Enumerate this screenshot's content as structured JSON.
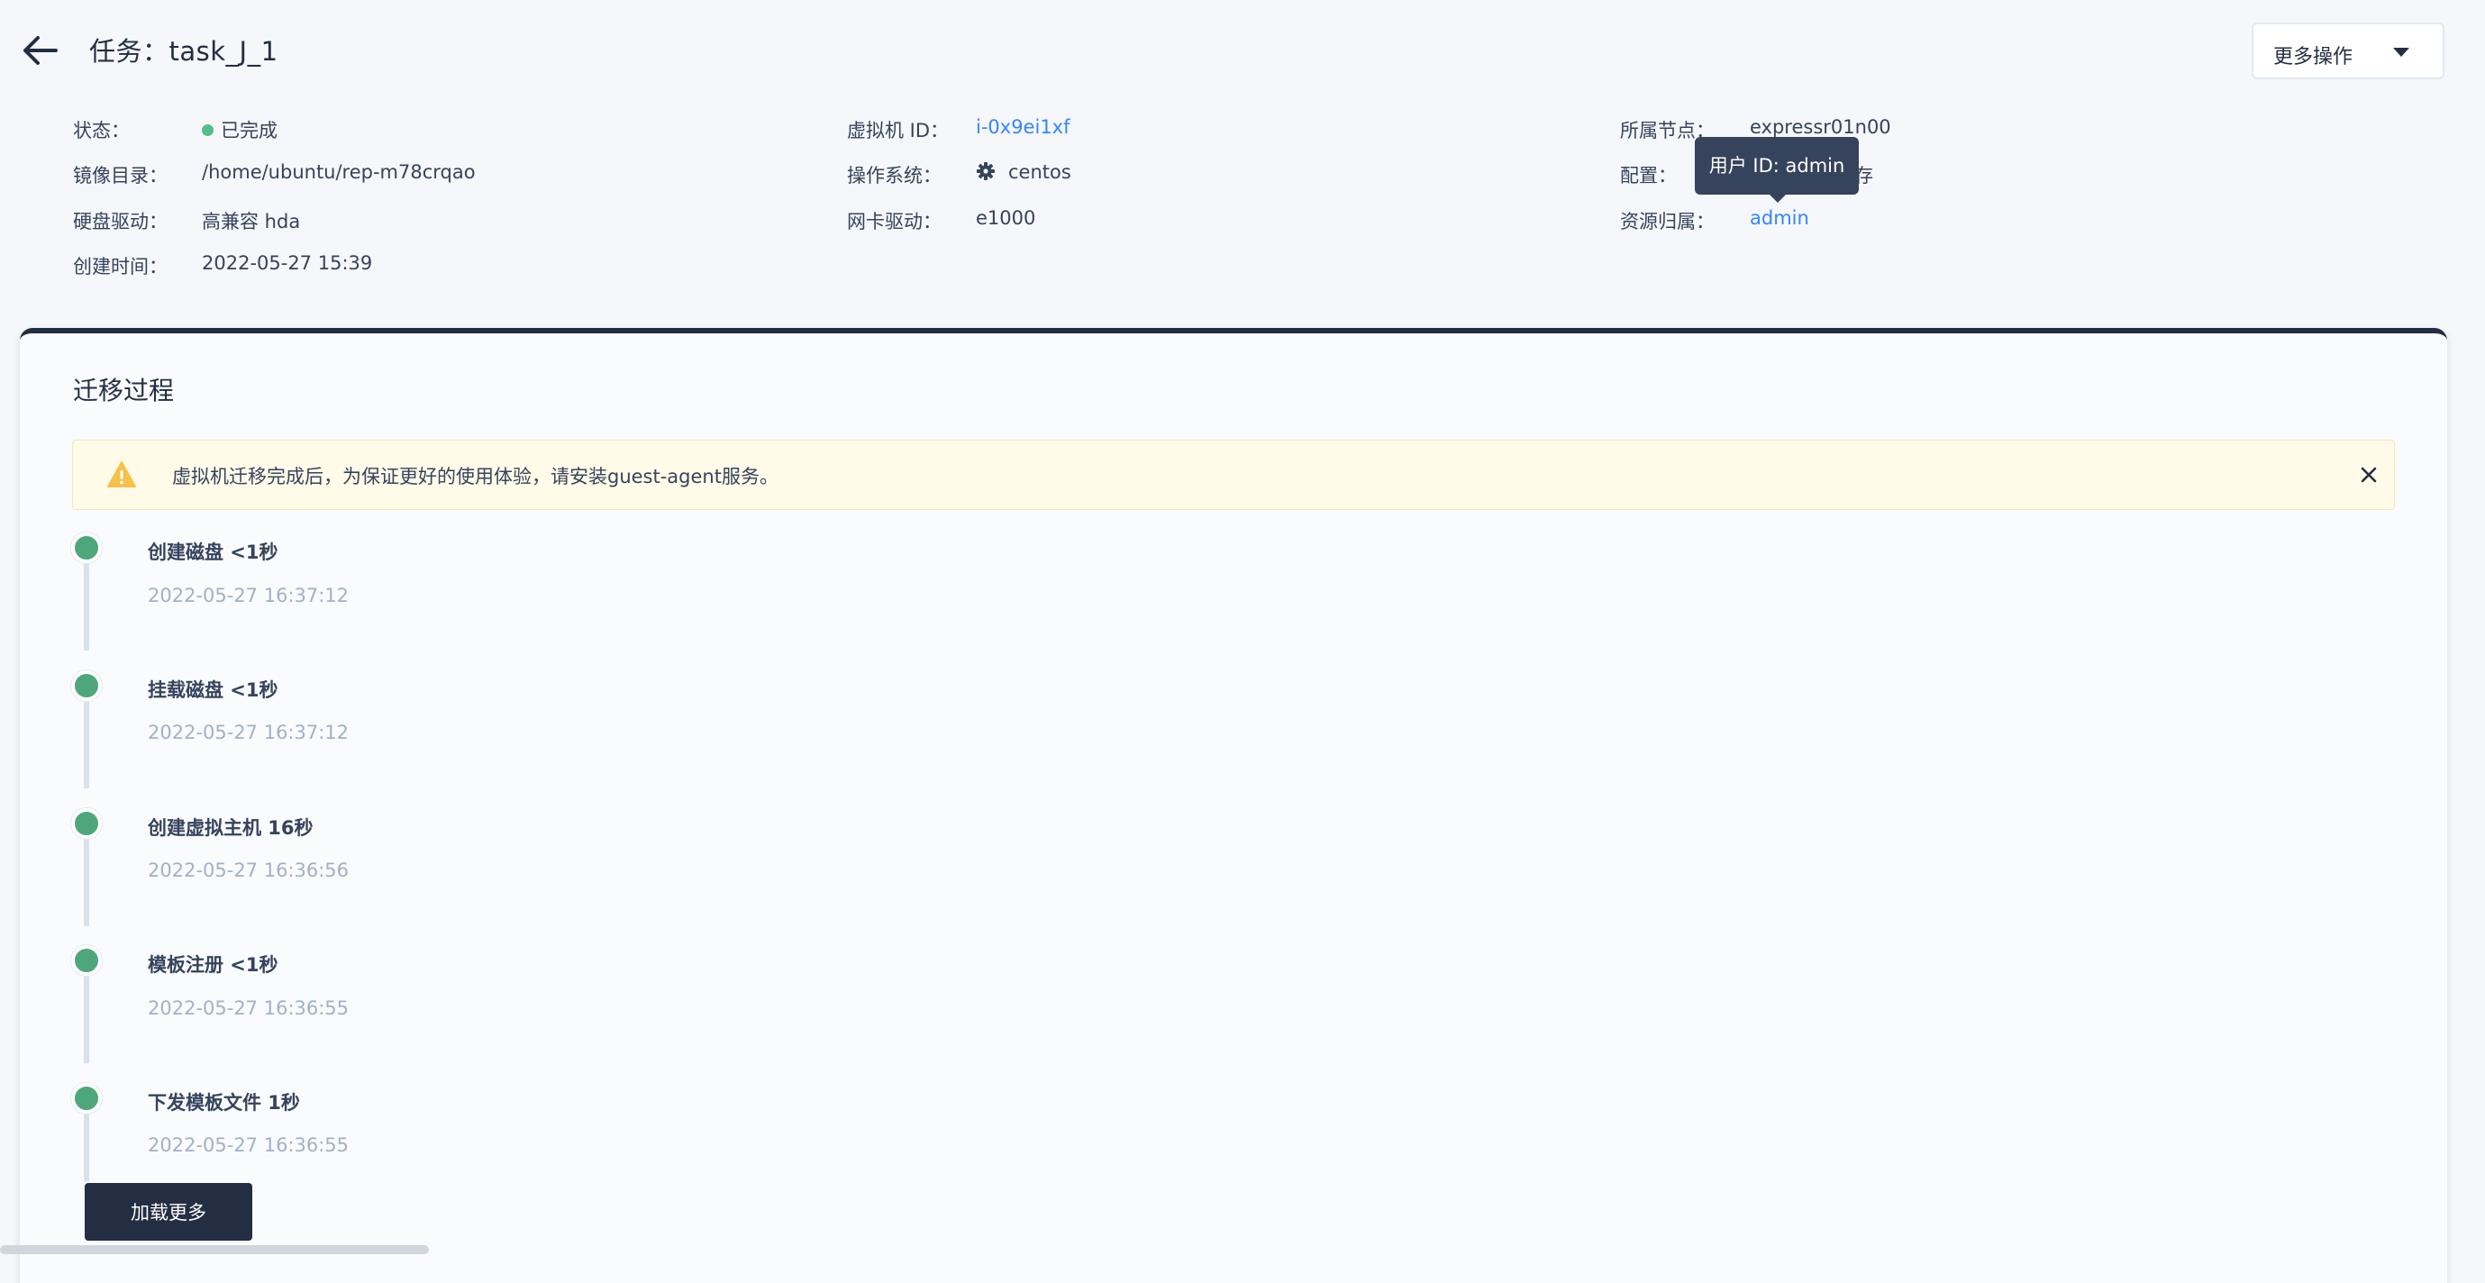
{
  "header": {
    "title": "任务：task_J_1",
    "more_actions_label": "更多操作"
  },
  "info": {
    "status_label": "状态：",
    "status_value": "已完成",
    "image_dir_label": "镜像目录：",
    "image_dir_value": "/home/ubuntu/rep-m78crqao",
    "disk_driver_label": "硬盘驱动：",
    "disk_driver_value": "高兼容 hda",
    "created_label": "创建时间：",
    "created_value": "2022-05-27 15:39",
    "vm_id_label": "虚拟机 ID：",
    "vm_id_value": "i-0x9ei1xf",
    "os_label": "操作系统：",
    "os_value": "centos",
    "nic_label": "网卡驱动：",
    "nic_value": "e1000",
    "node_label": "所属节点：",
    "node_value": "expressr01n00",
    "config_label": "配置：",
    "config_value_suffix": "存",
    "owner_label": "资源归属：",
    "owner_value": "admin"
  },
  "tooltip": {
    "text": "用户 ID: admin"
  },
  "migration": {
    "title": "迁移过程",
    "alert_text": "虚拟机迁移完成后，为保证更好的使用体验，请安装guest-agent服务。",
    "steps": [
      {
        "title": "创建磁盘  <1秒",
        "time": "2022-05-27 16:37:12"
      },
      {
        "title": "挂载磁盘  <1秒",
        "time": "2022-05-27 16:37:12"
      },
      {
        "title": "创建虚拟主机  16秒",
        "time": "2022-05-27 16:36:56"
      },
      {
        "title": "模板注册  <1秒",
        "time": "2022-05-27 16:36:55"
      },
      {
        "title": "下发模板文件  1秒",
        "time": "2022-05-27 16:36:55"
      }
    ],
    "load_more_label": "加载更多"
  },
  "colors": {
    "accent": "#242e42",
    "link": "#3385ff",
    "success": "#55bc8a",
    "timeline_dot": "#4ea77b"
  }
}
